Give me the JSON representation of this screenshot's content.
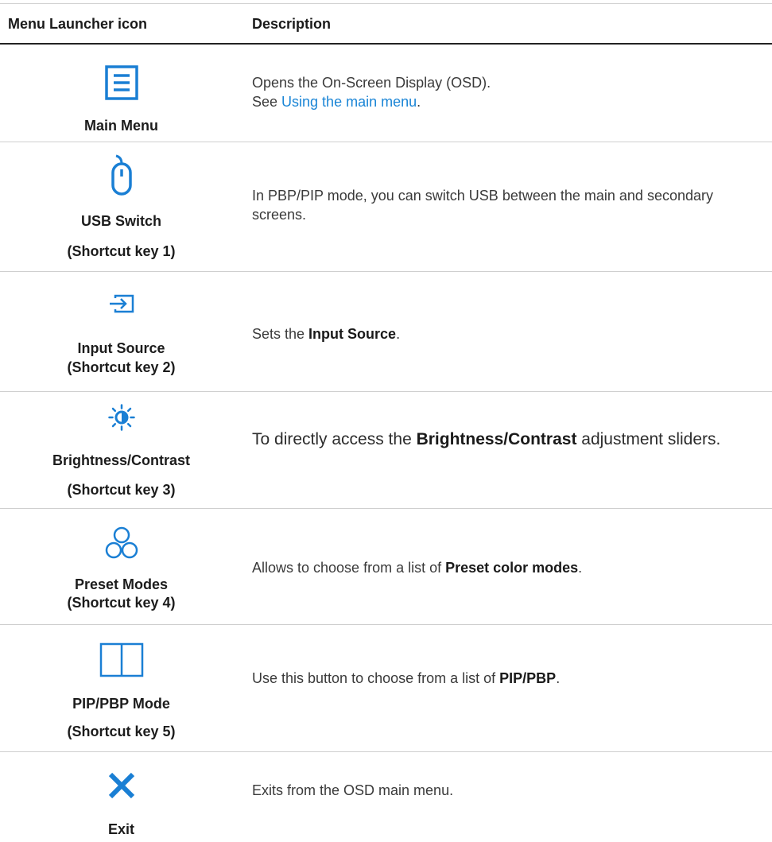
{
  "header": {
    "col1": "Menu Launcher icon",
    "col2": "Description"
  },
  "rows": [
    {
      "icon": "menu-list-icon",
      "label_line1": "Main Menu",
      "desc_line1": "Opens the On-Screen Display (OSD).",
      "desc_see": "See ",
      "desc_link": "Using the main menu",
      "desc_end": "."
    },
    {
      "icon": "mouse-icon",
      "label_line1": "USB Switch",
      "label_line2": "(Shortcut key 1)",
      "desc": "In PBP/PIP mode, you can switch USB between the main and secondary screens."
    },
    {
      "icon": "input-source-icon",
      "label_line1": "Input Source",
      "label_line2": "(Shortcut key 2)",
      "desc_pre": "Sets the ",
      "desc_bold": "Input Source",
      "desc_post": "."
    },
    {
      "icon": "brightness-contrast-icon",
      "label_line1": "Brightness/Contrast",
      "label_line2": "(Shortcut key 3)",
      "desc_pre": "To directly access the ",
      "desc_bold": "Brightness/Contrast",
      "desc_post": " adjustment sliders."
    },
    {
      "icon": "preset-modes-icon",
      "label_line1": "Preset Modes",
      "label_line2": "(Shortcut key 4)",
      "desc_pre": "Allows to choose from a list of ",
      "desc_bold": "Preset color modes",
      "desc_post": "."
    },
    {
      "icon": "pip-pbp-icon",
      "label_line1": "PIP/PBP Mode",
      "label_line2": "(Shortcut key 5)",
      "desc_pre": "Use this button to choose from a list of ",
      "desc_bold": "PIP/PBP",
      "desc_post": "."
    },
    {
      "icon": "close-x-icon",
      "label_line1": "Exit",
      "desc": "Exits from the OSD main menu."
    }
  ],
  "colors": {
    "icon_blue": "#1a7fd4",
    "link_blue": "#1a85d6",
    "rule": "#cfcfcf"
  }
}
